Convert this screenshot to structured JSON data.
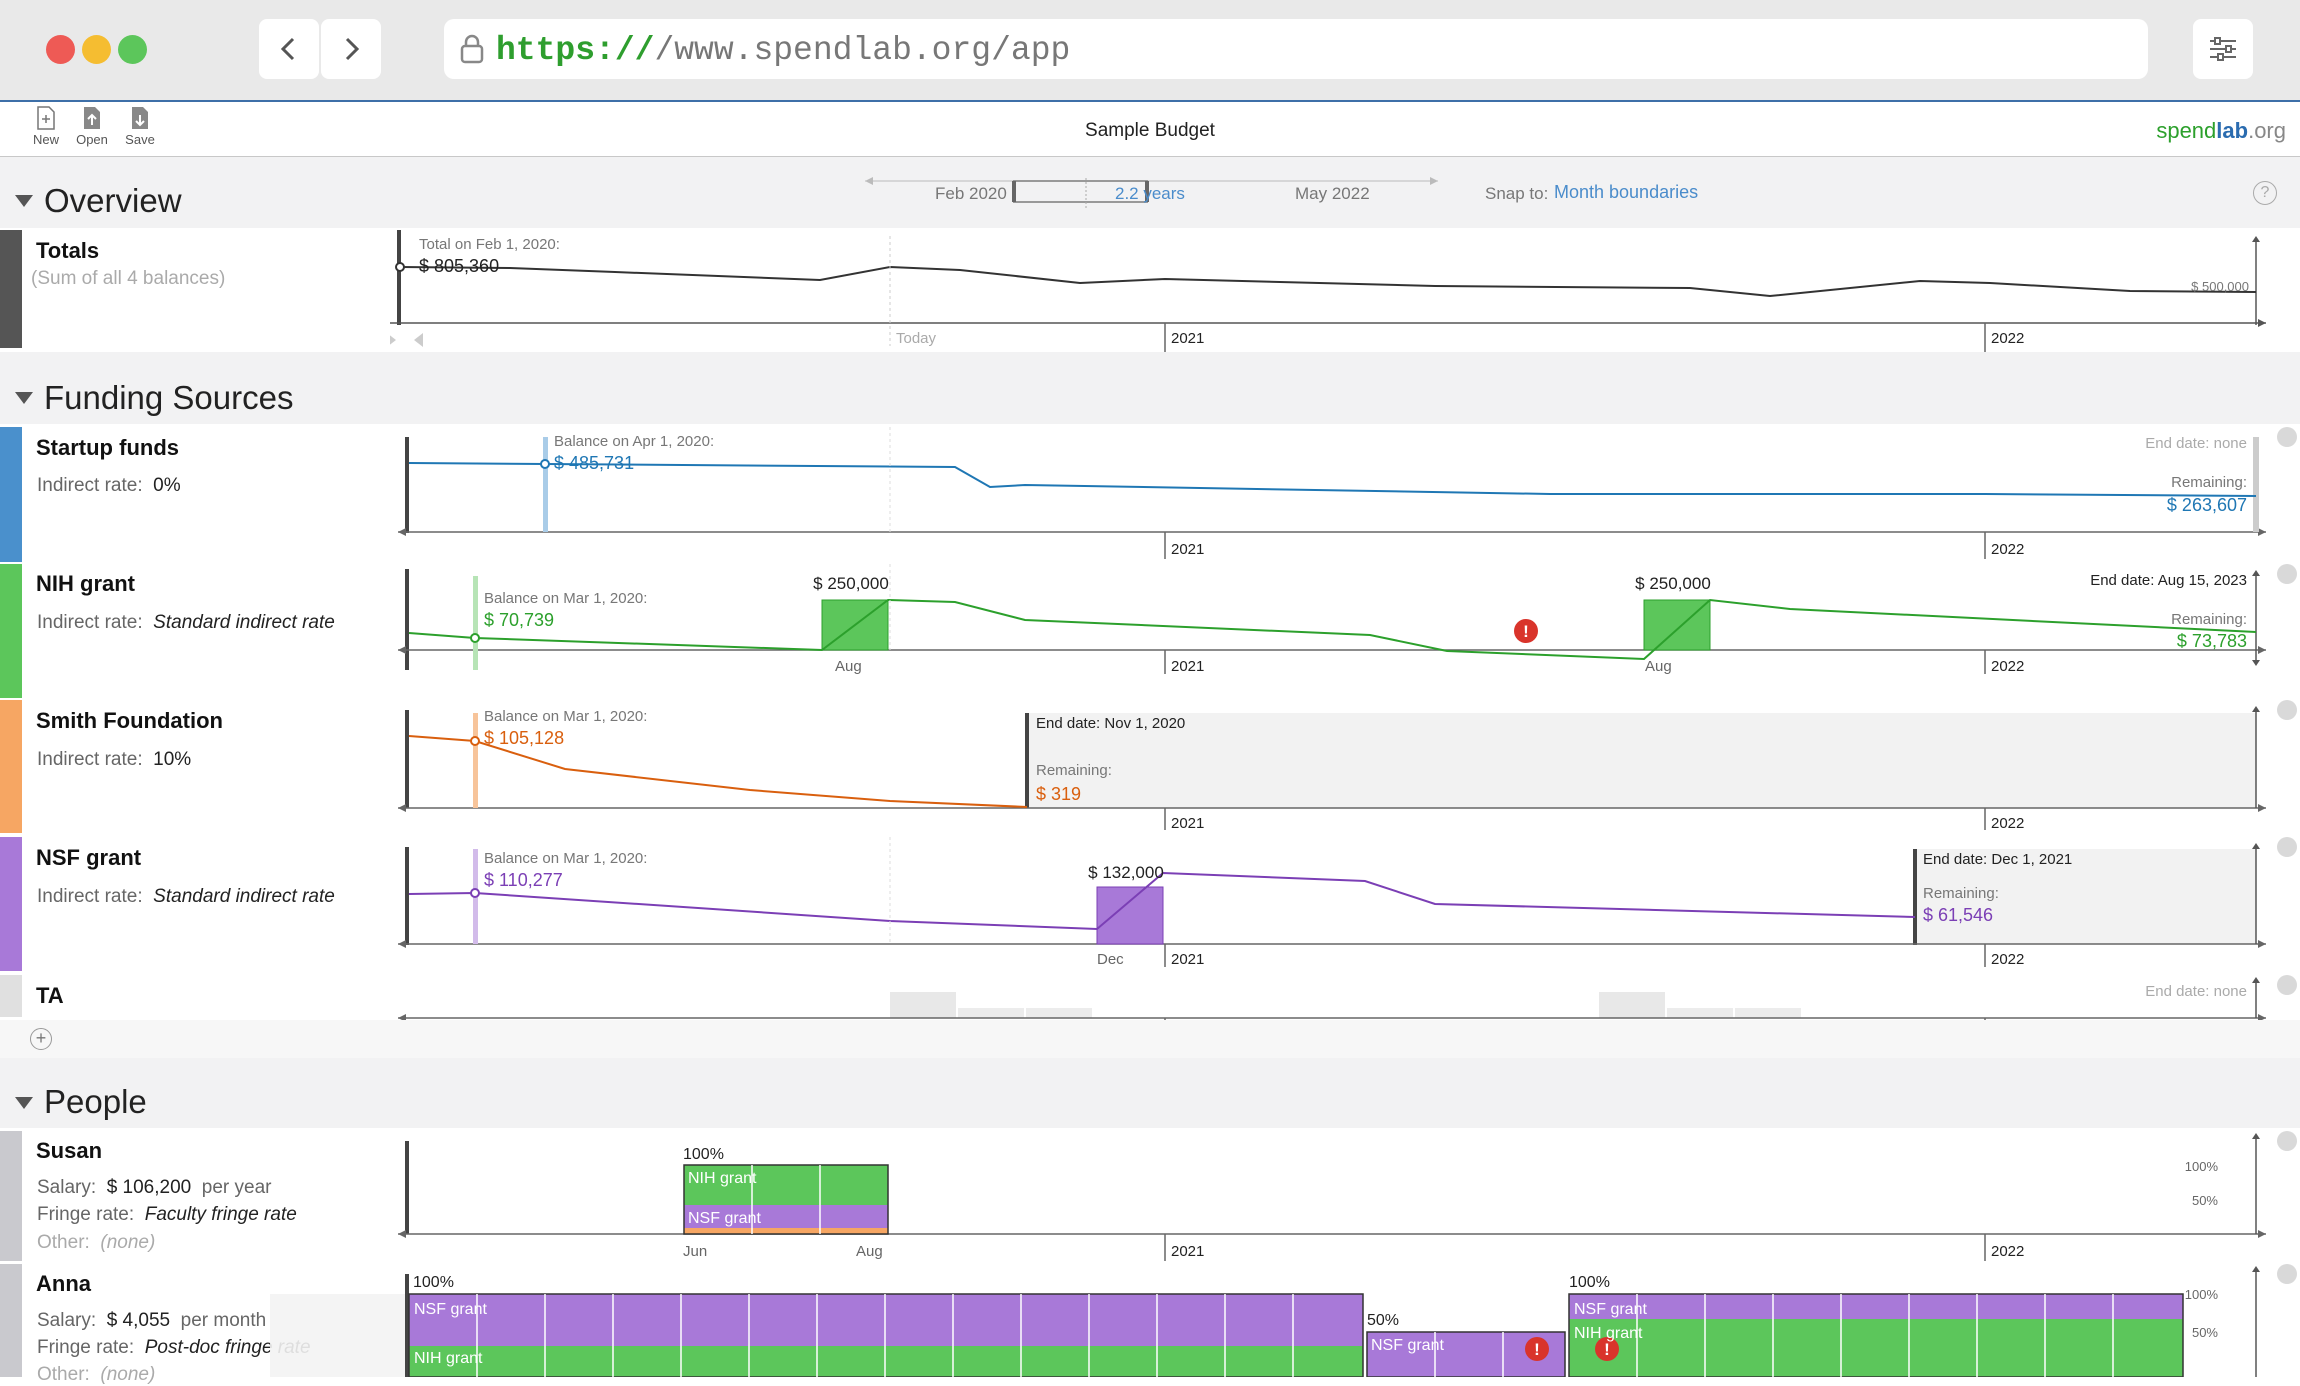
{
  "browser": {
    "url_scheme": "https://",
    "url_rest": "/www.spendlab.org/app"
  },
  "toolbar": {
    "new_label": "New",
    "open_label": "Open",
    "save_label": "Save"
  },
  "title": "Sample Budget",
  "brand": {
    "part1": "spend",
    "part2": "lab",
    "part3": ".org"
  },
  "overview": {
    "section_title": "Overview",
    "range": {
      "start": "Feb 2020",
      "length": "2.2 years",
      "end": "May 2022"
    },
    "snap_label": "Snap to:",
    "snap_value": "Month boundaries",
    "help": "?",
    "totals": {
      "name": "Totals",
      "subtitle": "(Sum of all 4 balances)",
      "marker_caption": "Total on Feb 1, 2020:",
      "marker_value": "$ 805,360",
      "scale_label": "$ 500,000",
      "today_label": "Today",
      "year_labels": [
        "2021",
        "2022"
      ]
    }
  },
  "funding": {
    "section_title": "Funding Sources",
    "indirect_label": "Indirect rate:",
    "remaining_label": "Remaining:",
    "items": [
      {
        "name": "Startup funds",
        "indirect_rate": "0%",
        "color": "#1f77b4",
        "marker_caption": "Balance on Apr 1, 2020:",
        "marker_value": "$ 485,731",
        "end_caption": "End date:",
        "end_value": "none",
        "remaining": "$ 263,607"
      },
      {
        "name": "NIH grant",
        "indirect_rate": "Standard indirect rate",
        "color": "#2ca02c",
        "marker_caption": "Balance on Mar 1, 2020:",
        "marker_value": "$ 70,739",
        "deposit1": "$ 250,000",
        "deposit2": "$ 250,000",
        "month1": "Aug",
        "month2": "Aug",
        "end_caption": "End date:",
        "end_value": "Aug 15, 2023",
        "remaining": "$ 73,783"
      },
      {
        "name": "Smith Foundation",
        "indirect_rate": "10%",
        "color": "#d95f0e",
        "marker_caption": "Balance on Mar 1, 2020:",
        "marker_value": "$ 105,128",
        "end_caption": "End date:",
        "end_value": "Nov 1, 2020",
        "remaining": "$ 319"
      },
      {
        "name": "NSF grant",
        "indirect_rate": "Standard indirect rate",
        "color": "#7b3fb5",
        "marker_caption": "Balance on Mar 1, 2020:",
        "marker_value": "$ 110,277",
        "deposit1": "$ 132,000",
        "month1": "Dec",
        "end_caption": "End date:",
        "end_value": "Dec 1, 2021",
        "remaining": "$ 61,546"
      },
      {
        "name": "TA",
        "end_caption": "End date:",
        "end_value": "none"
      }
    ],
    "year_labels": [
      "2021",
      "2022"
    ]
  },
  "people": {
    "section_title": "People",
    "salary_label": "Salary:",
    "fringe_label": "Fringe rate:",
    "other_label": "Other:",
    "items": [
      {
        "name": "Susan",
        "salary": "$ 106,200",
        "salary_period": "per year",
        "fringe": "Faculty fringe rate",
        "other": "(none)",
        "pct1": "100%",
        "src_top": "NIH grant",
        "src_bottom": "NSF grant",
        "month_start": "Jun",
        "month_end": "Aug"
      },
      {
        "name": "Anna",
        "salary": "$ 4,055",
        "salary_period": "per month",
        "fringe": "Post-doc fringe rate",
        "other": "(none)",
        "pct1": "100%",
        "pct2": "50%",
        "pct3": "100%",
        "src_a": "NSF grant",
        "src_b": "NIH grant",
        "src_c": "NSF grant",
        "src_d": "NSF grant",
        "src_e": "NIH grant"
      }
    ],
    "axis_100": "100%",
    "axis_50": "50%",
    "year_labels": [
      "2021",
      "2022"
    ]
  },
  "warning_glyph": "!"
}
